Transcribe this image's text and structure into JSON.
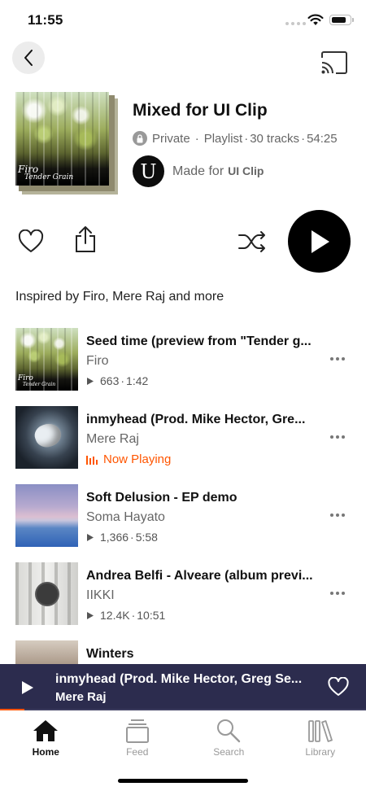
{
  "status_bar": {
    "time": "11:55"
  },
  "playlist": {
    "cover_signature": {
      "artist": "Firo",
      "title": "Tender Grain"
    },
    "title": "Mixed for UI Clip",
    "privacy": "Private",
    "meta_sep": "·",
    "type": "Playlist",
    "track_count": "30 tracks",
    "duration": "54:25",
    "made_for_prefix": "Made for",
    "made_for_user": "UI Clip",
    "avatar_letter": "U",
    "inspired_text": "Inspired by Firo, Mere Raj and more"
  },
  "tracks": [
    {
      "title": "Seed time (preview from \"Tender g...",
      "artist": "Firo",
      "plays": "663",
      "duration": "1:42",
      "sep": "·",
      "now_playing": false,
      "cover": "forest"
    },
    {
      "title": "inmyhead (Prod. Mike Hector, Gre...",
      "artist": "Mere Raj",
      "status": "Now Playing",
      "now_playing": true,
      "cover": "headphones"
    },
    {
      "title": "Soft Delusion - EP demo",
      "artist": "Soma Hayato",
      "plays": "1,366",
      "duration": "5:58",
      "sep": "·",
      "now_playing": false,
      "cover": "sky"
    },
    {
      "title": "Andrea Belfi - Alveare (album previ...",
      "artist": "IIKKI",
      "plays": "12.4K",
      "duration": "10:51",
      "sep": "·",
      "now_playing": false,
      "cover": "corridor"
    },
    {
      "title": "Winters",
      "cover": "winter"
    }
  ],
  "mini_player": {
    "title": "inmyhead (Prod. Mike Hector, Greg Se...",
    "artist": "Mere Raj",
    "progress": 0.067
  },
  "tabs": [
    {
      "label": "Home",
      "icon": "home-icon",
      "active": true
    },
    {
      "label": "Feed",
      "icon": "feed-icon",
      "active": false
    },
    {
      "label": "Search",
      "icon": "search-icon",
      "active": false
    },
    {
      "label": "Library",
      "icon": "library-icon",
      "active": false
    }
  ],
  "colors": {
    "accent": "#ff5500",
    "mini_player_bg": "#2c2c4e",
    "play_button": "#000000"
  }
}
